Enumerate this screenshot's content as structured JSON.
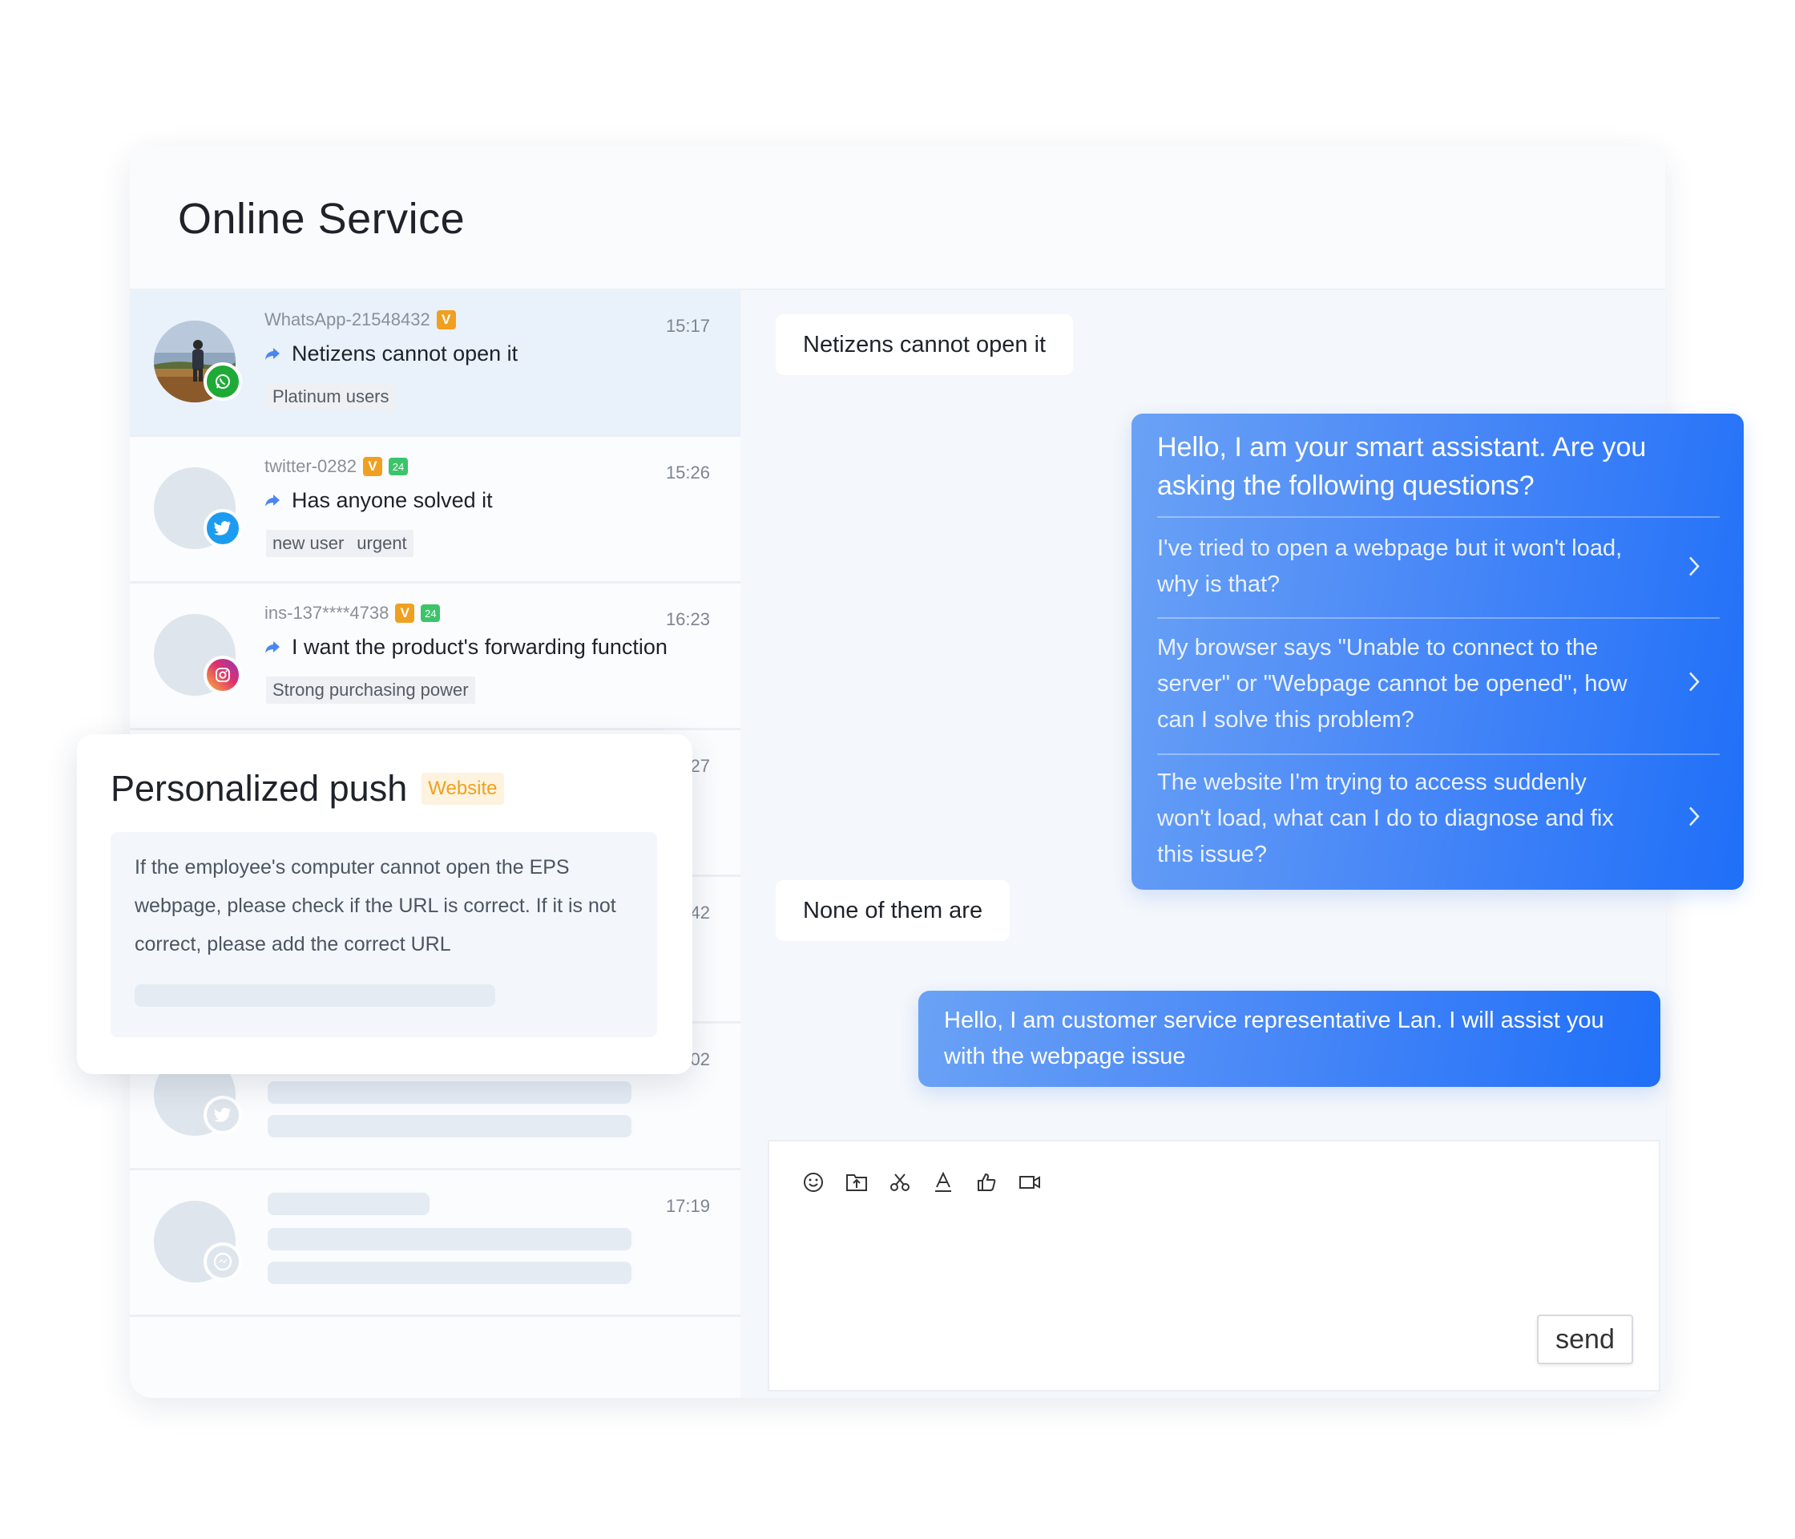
{
  "page": {
    "title": "Online Service"
  },
  "conversations": [
    {
      "name": "WhatsApp-21548432",
      "channel": "whatsapp",
      "vip": "V",
      "time": "15:17",
      "message": "Netizens cannot open it",
      "tags": [
        "Platinum users"
      ]
    },
    {
      "name": "twitter-0282",
      "channel": "twitter",
      "vip": "V",
      "hours": "24",
      "time": "15:26",
      "message": "Has anyone solved it",
      "tags": [
        "new user",
        "urgent"
      ]
    },
    {
      "name": "ins-137****4738",
      "channel": "instagram",
      "vip": "V",
      "hours": "24",
      "time": "16:23",
      "message": "I want the product's forwarding function",
      "tags": [
        "Strong purchasing power"
      ]
    },
    {
      "time": ":27"
    },
    {
      "time": ":42"
    },
    {
      "time": ":02",
      "channel": "twitter"
    },
    {
      "time": "17:19",
      "channel": "messenger"
    }
  ],
  "chat": {
    "incoming_1": "Netizens cannot open it",
    "bot": {
      "greeting": "Hello, I am your smart assistant. Are you asking the following questions?",
      "questions": [
        "I've tried to open a webpage but it won't load, why is that?",
        "My browser says \"Unable to connect to the server\" or \"Webpage cannot be opened\", how can I solve this problem?",
        "The website I'm trying to access suddenly won't load, what can I do to diagnose and fix this issue?"
      ]
    },
    "incoming_2": "None of them are",
    "agent_reply": "Hello, I am customer service representative Lan. I will assist you with the webpage issue"
  },
  "composer": {
    "tools": [
      "emoji-icon",
      "folder-upload-icon",
      "scissors-icon",
      "text-format-icon",
      "thumbs-up-icon",
      "video-icon"
    ],
    "send_label": "send"
  },
  "push_panel": {
    "title": "Personalized push",
    "tag": "Website",
    "text": "If the employee's computer cannot open the EPS webpage, please check if the URL is correct. If it is not correct, please add the correct URL"
  },
  "colors": {
    "accent": "#1f6ff8",
    "whatsapp": "#1faa37",
    "twitter": "#1d9bf0",
    "vip": "#f0a020",
    "hours": "#3cc46a"
  }
}
